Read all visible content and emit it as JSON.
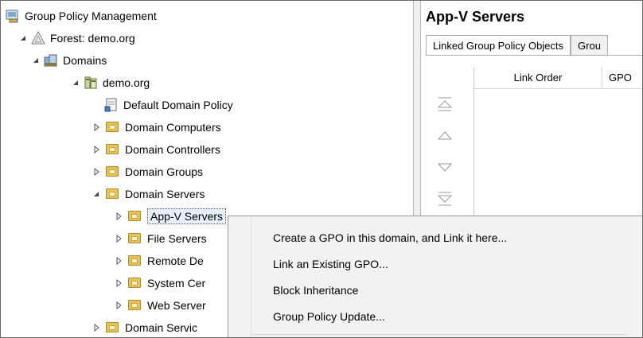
{
  "tree": {
    "items": [
      {
        "label": "Group Policy Management"
      },
      {
        "label": "Forest: demo.org"
      },
      {
        "label": "Domains"
      },
      {
        "label": "demo.org"
      },
      {
        "label": "Default Domain Policy"
      },
      {
        "label": "Domain Computers"
      },
      {
        "label": "Domain Controllers"
      },
      {
        "label": "Domain Groups"
      },
      {
        "label": "Domain Servers"
      },
      {
        "label": "App-V Servers"
      },
      {
        "label": "File Servers"
      },
      {
        "label": "Remote De"
      },
      {
        "label": "System Cer"
      },
      {
        "label": "Web Server"
      },
      {
        "label": "Domain Servic"
      }
    ]
  },
  "details": {
    "title": "App-V Servers",
    "tabs": [
      {
        "label": "Linked Group Policy Objects"
      },
      {
        "label": "Grou"
      }
    ],
    "columns": [
      {
        "label": "Link Order"
      },
      {
        "label": "GPO"
      }
    ]
  },
  "context_menu": {
    "items": [
      {
        "label": "Create a GPO in this domain, and Link it here..."
      },
      {
        "label": "Link an Existing GPO..."
      },
      {
        "label": "Block Inheritance"
      },
      {
        "label": "Group Policy Update..."
      }
    ]
  },
  "colors": {
    "folder": "#e6c25a",
    "selection": "#e6f0fb",
    "menu_bg": "#f2f2f2"
  }
}
